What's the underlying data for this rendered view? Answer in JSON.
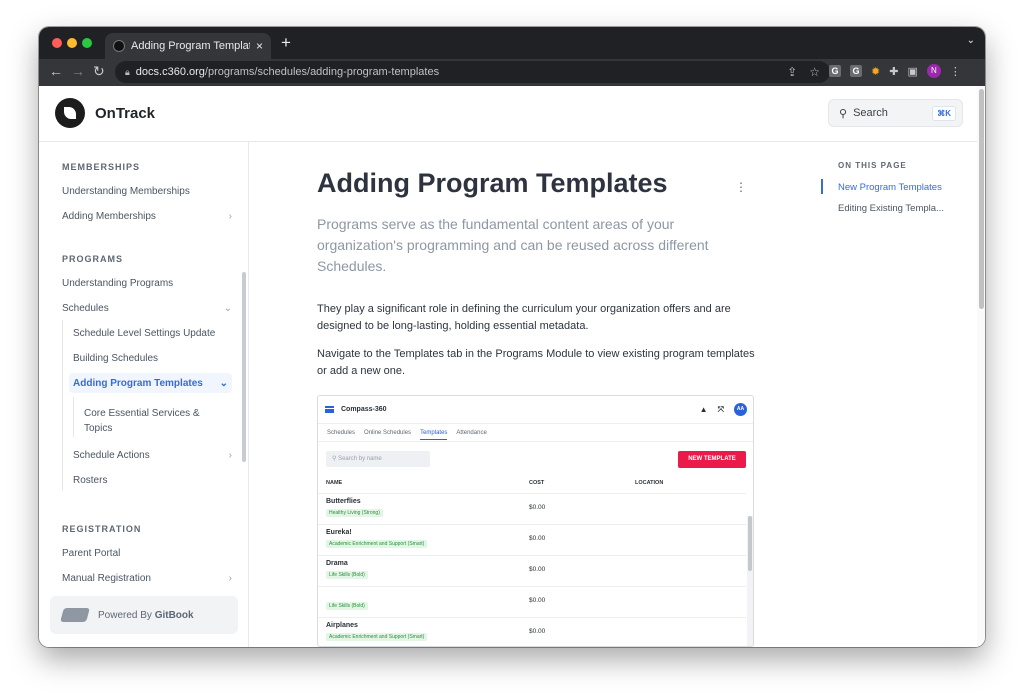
{
  "browser": {
    "tab_title": "Adding Program Templates - O",
    "tab_close": "×",
    "new_tab": "+",
    "url_domain": "docs.c360.org",
    "url_path": "/programs/schedules/adding-program-templates",
    "ext_g1": "G",
    "ext_g2": "G",
    "profile_initial": "N"
  },
  "header": {
    "brand": "OnTrack",
    "search_label": "Search",
    "search_shortcut": "⌘K"
  },
  "sidebar": {
    "sec_memberships": "MEMBERSHIPS",
    "understanding_memberships": "Understanding Memberships",
    "adding_memberships": "Adding Memberships",
    "sec_programs": "PROGRAMS",
    "understanding_programs": "Understanding Programs",
    "schedules": "Schedules",
    "schedule_level_settings": "Schedule Level Settings Update",
    "building_schedules": "Building Schedules",
    "adding_program_templates": "Adding Program Templates",
    "core_essential": "Core Essential Services & Topics",
    "schedule_actions": "Schedule Actions",
    "rosters": "Rosters",
    "sec_registration": "REGISTRATION",
    "parent_portal": "Parent Portal",
    "manual_registration": "Manual Registration",
    "powered_prefix": "Powered By ",
    "powered_brand": "GitBook"
  },
  "main": {
    "title": "Adding Program Templates",
    "lead": "Programs serve as the fundamental content areas of your organization's programming and can be reused across different Schedules.",
    "p1": "They play a significant role in defining the curriculum your organization offers and are designed to be long-lasting, holding essential metadata.",
    "p2": "Navigate to the Templates tab in the Programs Module to view existing program templates or add a new one."
  },
  "embedded": {
    "app_name": "Compass-360",
    "avatar": "AA",
    "tabs": [
      "Schedules",
      "Online Schedules",
      "Templates",
      "Attendance"
    ],
    "search_placeholder": "Search by name",
    "new_template": "NEW TEMPLATE",
    "col_name": "NAME",
    "col_cost": "COST",
    "col_location": "LOCATION",
    "rows": [
      {
        "name": "Butterflies",
        "tag": "Healthy Living (Strong)",
        "cost": "$0.00"
      },
      {
        "name": "Eureka!",
        "tag": "Academic Enrichment and Support (Smart)",
        "cost": "$0.00"
      },
      {
        "name": "Drama",
        "tag": "Life Skills (Bold)",
        "cost": "$0.00"
      },
      {
        "name": "",
        "tag": "Life Skills (Bold)",
        "cost": "$0.00"
      },
      {
        "name": "Airplanes",
        "tag": "Academic Enrichment and Support (Smart)",
        "cost": "$0.00"
      }
    ]
  },
  "toc": {
    "heading": "ON THIS PAGE",
    "item1": "New Program Templates",
    "item2": "Editing Existing Templa..."
  },
  "colors": {
    "accent": "#346ddb",
    "new_template_bg": "#ea1b4b"
  }
}
